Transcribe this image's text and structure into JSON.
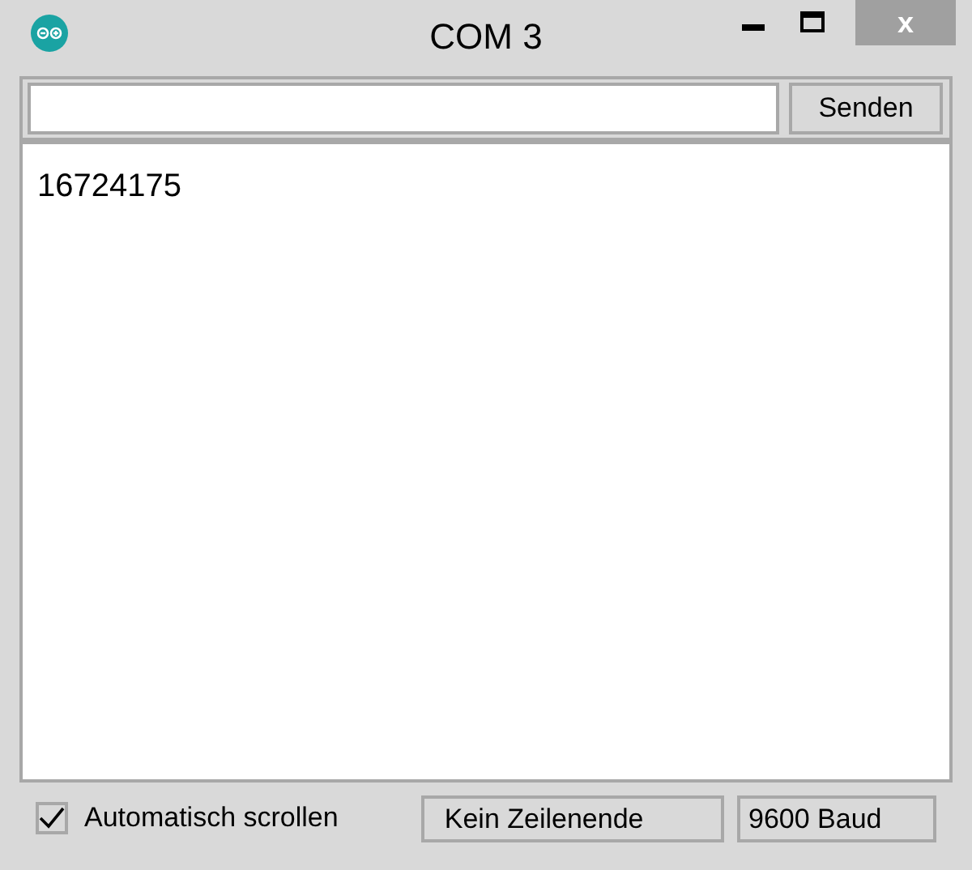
{
  "window": {
    "title": "COM 3",
    "close": "x"
  },
  "send_button": "Senden",
  "output_lines": [
    "16724175"
  ],
  "autoscroll": {
    "label": "Automatisch scrollen",
    "checked": true
  },
  "line_ending": "Kein Zeilenende",
  "baud": "9600 Baud"
}
